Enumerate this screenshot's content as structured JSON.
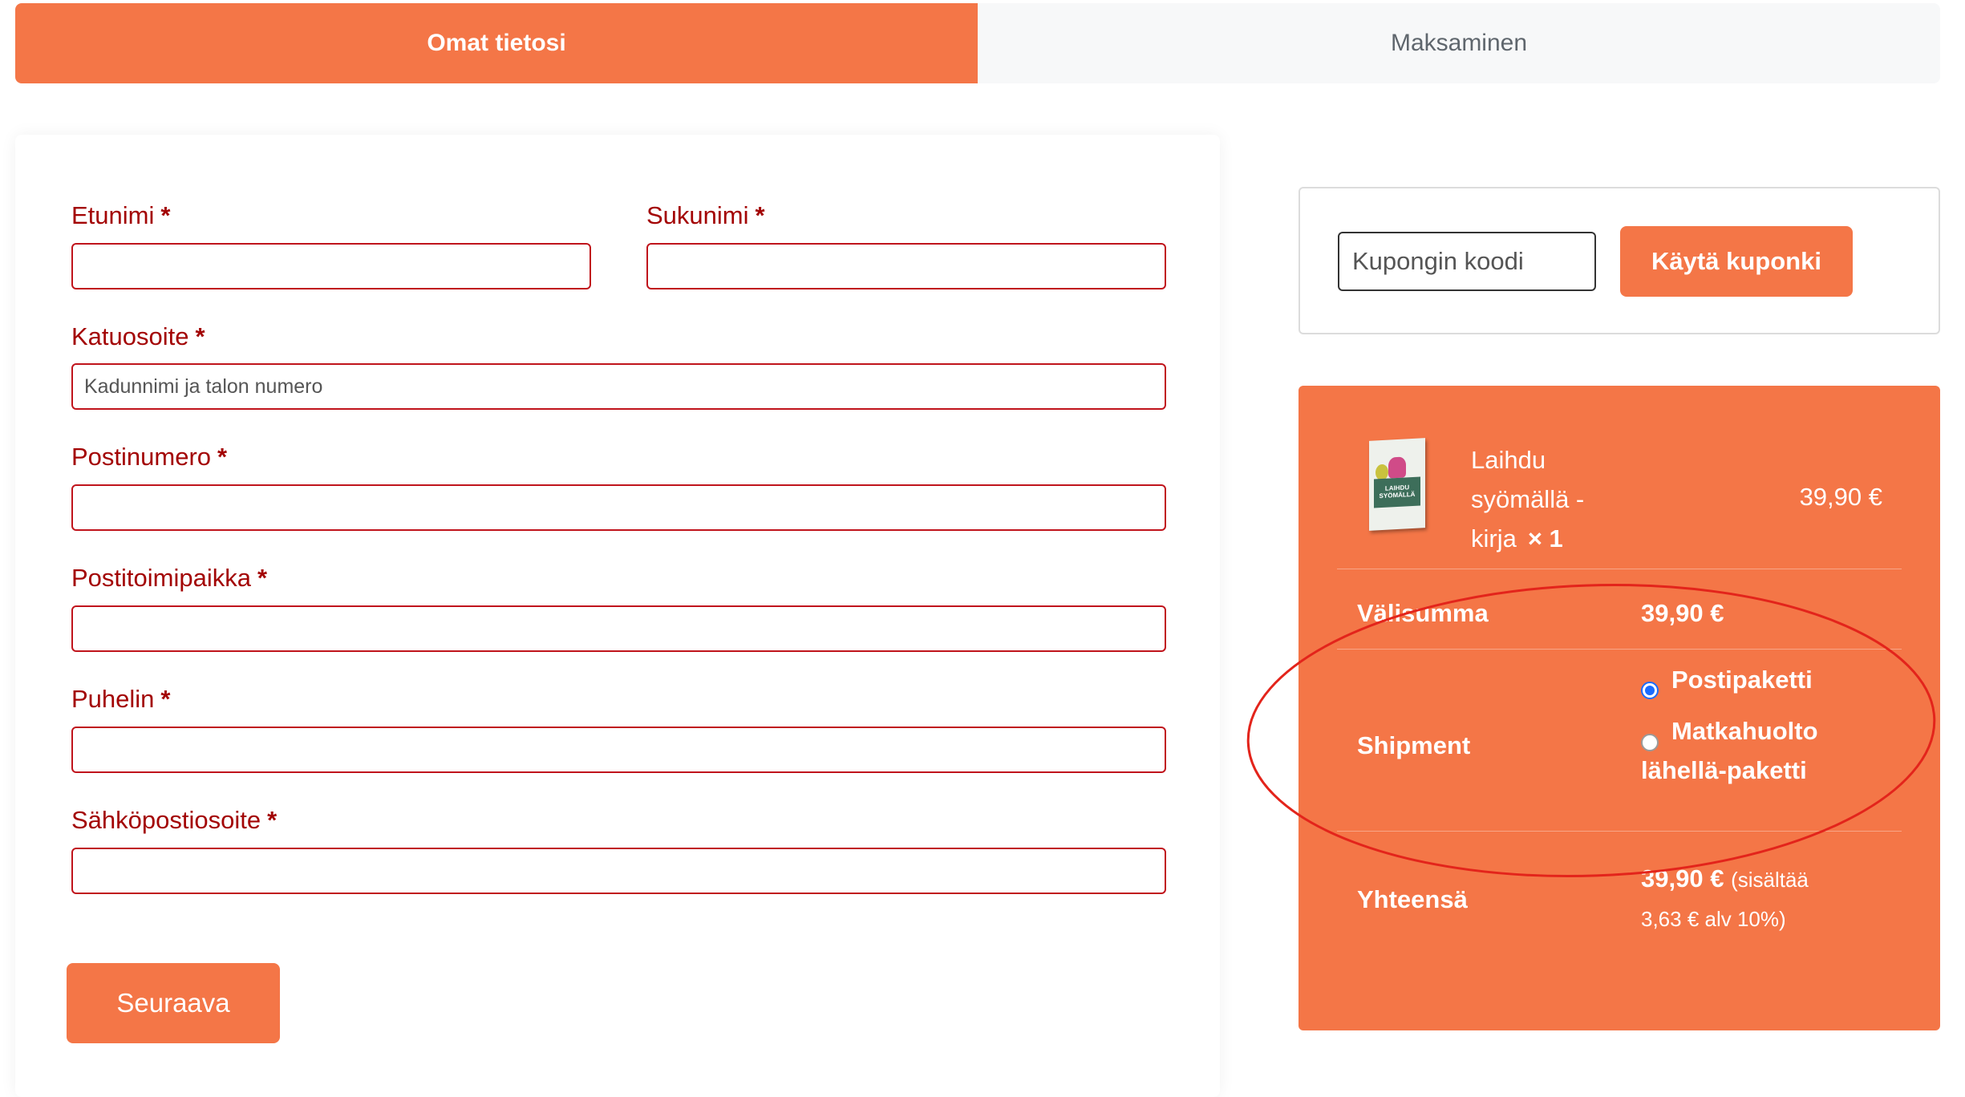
{
  "tabs": [
    {
      "label": "Omat tietosi",
      "active": true
    },
    {
      "label": "Maksaminen",
      "active": false
    }
  ],
  "form": {
    "fields": [
      {
        "label": "Etunimi",
        "required_mark": "*",
        "value": "",
        "placeholder": ""
      },
      {
        "label": "Sukunimi",
        "required_mark": "*",
        "value": "",
        "placeholder": ""
      },
      {
        "label": "Katuosoite",
        "required_mark": "*",
        "value": "",
        "placeholder": "Kadunnimi ja talon numero"
      },
      {
        "label": "Postinumero",
        "required_mark": "*",
        "value": "",
        "placeholder": ""
      },
      {
        "label": "Postitoimipaikka",
        "required_mark": "*",
        "value": "",
        "placeholder": ""
      },
      {
        "label": "Puhelin",
        "required_mark": "*",
        "value": "",
        "placeholder": ""
      },
      {
        "label": "Sähköpostiosoite",
        "required_mark": "*",
        "value": "",
        "placeholder": ""
      }
    ],
    "next_label": "Seuraava"
  },
  "coupon": {
    "placeholder": "Kupongin koodi",
    "button_label": "Käytä kuponki"
  },
  "summary": {
    "product": {
      "name_lines": [
        "Laihdu",
        "syömällä -",
        "kirja"
      ],
      "quantity": "× 1",
      "price": "39,90 €",
      "cover_text": "LAIHDU SYÖMÄLLÄ"
    },
    "subtotal": {
      "label": "Välisumma",
      "value": "39,90 €"
    },
    "shipment": {
      "label": "Shipment",
      "options": [
        {
          "lines": [
            "Postipaketti"
          ],
          "selected": true
        },
        {
          "lines": [
            "Matkahuolto",
            "lähellä-paketti"
          ],
          "selected": false
        }
      ]
    },
    "total": {
      "label": "Yhteensä",
      "value": "39,90 €",
      "tax_note_1": "(sisältää",
      "tax_note_2": "3,63 € alv 10%)"
    }
  },
  "colors": {
    "accent": "#f47647",
    "label_red": "#a30404",
    "input_border": "#c0141c",
    "annotation_red": "#e3241b"
  }
}
